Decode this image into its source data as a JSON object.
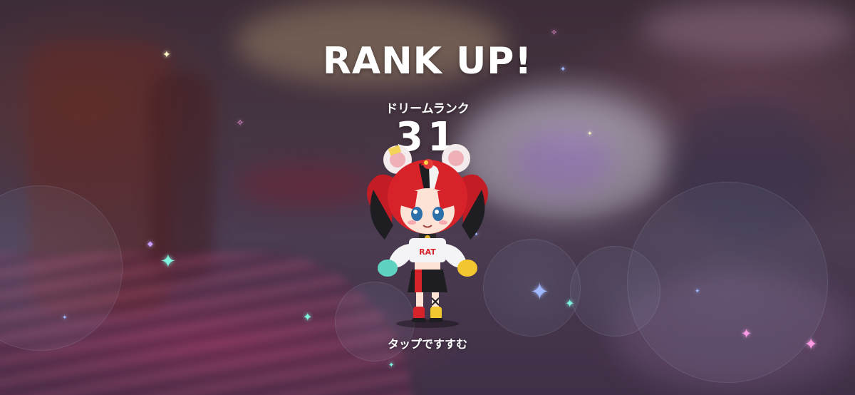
{
  "screen": {
    "title": "RANK UP!",
    "rank_label": "ドリームランク",
    "rank_value": "31",
    "tap_prompt": "タップですすむ"
  },
  "character": {
    "shirt_text": "RAT"
  },
  "colors": {
    "text": "#ffffff",
    "hair_red": "#d8222a",
    "hair_black": "#222226",
    "sparkle_cyan": "#7ff5e0",
    "sparkle_blue": "#9fb8ff",
    "sparkle_pink": "#ff9be6"
  }
}
